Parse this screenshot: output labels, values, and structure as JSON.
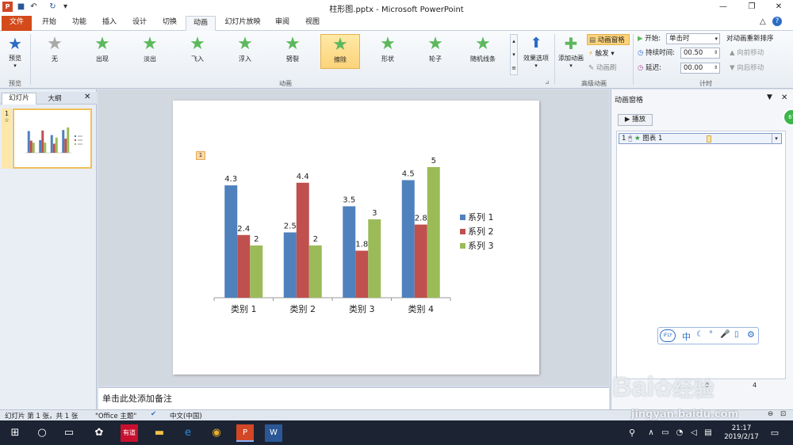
{
  "window": {
    "title": "柱形图.pptx - Microsoft PowerPoint",
    "badge": "67"
  },
  "tabs": [
    "文件",
    "开始",
    "功能",
    "插入",
    "设计",
    "切换",
    "动画",
    "幻灯片放映",
    "审阅",
    "视图"
  ],
  "ribbon": {
    "preview_label": "预览",
    "preview_group": "预览",
    "animations": [
      "无",
      "出现",
      "淡出",
      "飞入",
      "浮入",
      "劈裂",
      "擦除",
      "形状",
      "轮子",
      "随机线条"
    ],
    "selected_animation": "擦除",
    "effect_options": "效果选项",
    "animation_group": "动画",
    "add_animation": "添加动画",
    "anim_pane": "动画窗格",
    "trigger": "触发",
    "anim_painter": "动画刷",
    "advanced_group": "高级动画",
    "start_label": "开始:",
    "start_value": "单击时",
    "duration_label": "持续时间:",
    "duration_value": "00.50",
    "delay_label": "延迟:",
    "delay_value": "00.00",
    "timing_group": "计时",
    "reorder_title": "对动画重新排序",
    "move_earlier": "向前移动",
    "move_later": "向后移动"
  },
  "left_pane": {
    "tab_slides": "幻灯片",
    "tab_outline": "大纲",
    "slide_number": "1",
    "slide_mark": "☆"
  },
  "slide": {
    "anim_tag": "1"
  },
  "chart_data": {
    "type": "bar",
    "categories": [
      "类别 1",
      "类别 2",
      "类别 3",
      "类别 4"
    ],
    "series": [
      {
        "name": "系列 1",
        "values": [
          4.3,
          2.5,
          3.5,
          4.5
        ],
        "color": "#4f81bd"
      },
      {
        "name": "系列 2",
        "values": [
          2.4,
          4.4,
          1.8,
          2.8
        ],
        "color": "#c0504d"
      },
      {
        "name": "系列 3",
        "values": [
          2,
          2,
          3,
          5
        ],
        "color": "#9bbb59"
      }
    ],
    "ylim": [
      0,
      5
    ],
    "grid": false,
    "legend": "right",
    "data_labels": true
  },
  "notes": {
    "placeholder": "单击此处添加备注"
  },
  "right_pane": {
    "title": "动画窗格",
    "play": "播放",
    "item_index": "1",
    "item_name": "图表 1",
    "sec_start": "0",
    "sec_end": "4"
  },
  "ifly": {
    "logo": "iFLY",
    "mode": "中"
  },
  "status": {
    "slide_info": "幻灯片 第 1 张，共 1 张",
    "theme": "\"Office 主题\"",
    "language": "中文(中国)"
  },
  "taskbar": {
    "time": "21:17",
    "date": "2019/2/17"
  },
  "watermark": {
    "brand": "Bai",
    "brand2": "经验",
    "url": "jingyan.baidu.com"
  }
}
